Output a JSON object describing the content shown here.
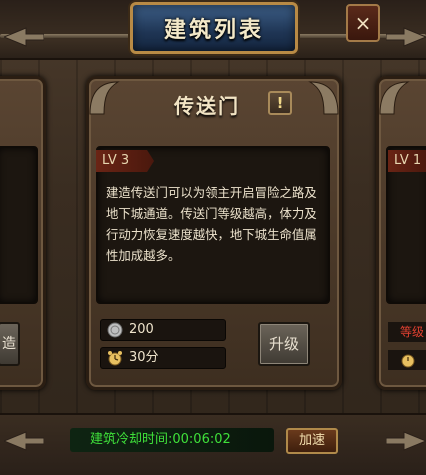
{
  "header": {
    "title": "建筑列表",
    "close_label": "×"
  },
  "card": {
    "title": "传送门",
    "info_label": "!",
    "level": "LV 3",
    "description": "建造传送门可以为领主开启冒险之路及地下城通道。传送门等级越高，体力及行动力恢复速度越快，地下城生命值属性加成越多。",
    "cost_value": "200",
    "time_value": "30分",
    "upgrade_label": "升级"
  },
  "left_card": {
    "button_fragment": "造"
  },
  "right_card": {
    "level_fragment": "LV 1",
    "red_fragment": "等级"
  },
  "footer": {
    "cooldown_text": "建筑冷却时间:00:06:02",
    "speedup_label": "加速"
  },
  "colors": {
    "cooldown_green": "#3fe03a",
    "title_blue": "#1f3554",
    "gold_trim": "#b88a45"
  }
}
